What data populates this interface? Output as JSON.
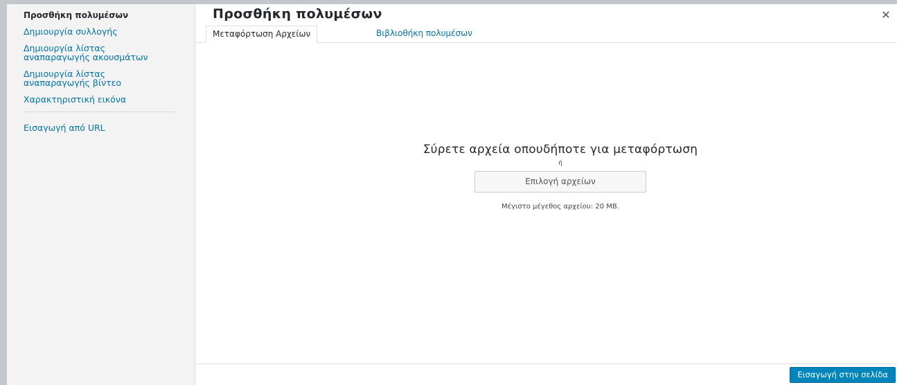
{
  "sidebar": {
    "items": [
      {
        "label": "Προσθήκη πολυμέσων"
      },
      {
        "label": "Δημιουργία συλλογής"
      },
      {
        "label": "Δημιουργία λίστας αναπαραγωγής ακουσμάτων"
      },
      {
        "label": "Δημιουργία λίστας αναπαραγωγής βίντεο"
      },
      {
        "label": "Χαρακτηριστική εικόνα"
      },
      {
        "label": "Εισαγωγή από URL"
      }
    ]
  },
  "header": {
    "title": "Προσθήκη πολυμέσων",
    "close_glyph": "✕"
  },
  "tabs": [
    {
      "label": "Μεταφόρτωση Αρχείων"
    },
    {
      "label": "Βιβλιοθήκη πολυμέσων"
    }
  ],
  "upload": {
    "headline": "Σύρετε αρχεία οπουδήποτε για μεταφόρτωση",
    "or": "ή",
    "select_button": "Επιλογή αρχείων",
    "max_size": "Μέγιστο μέγεθος αρχείου: 20 MB."
  },
  "toolbar": {
    "insert_button": "Εισαγωγή στην σελίδα"
  },
  "colors": {
    "link": "#0073aa",
    "primary_button": "#0085ba",
    "backdrop": "#c3c7cc"
  }
}
